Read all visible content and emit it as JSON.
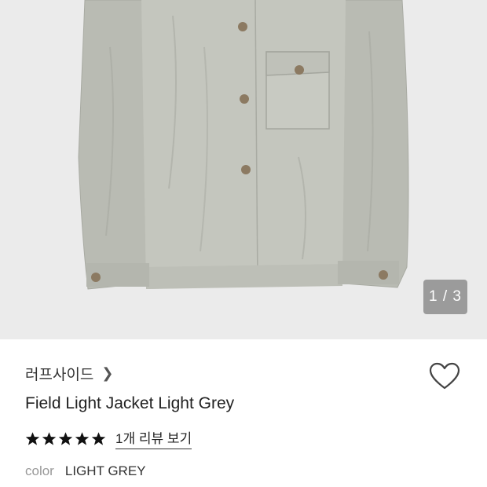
{
  "gallery": {
    "current": "1",
    "total": "3",
    "indicator": "1 / 3"
  },
  "product": {
    "brand": "러프사이드",
    "title": "Field Light Jacket Light Grey",
    "rating": 5,
    "review_link": "1개 리뷰 보기",
    "color_label": "color",
    "color_value": "LIGHT GREY"
  },
  "icons": {
    "brand_chevron": "chevron-right-icon",
    "wishlist": "heart-icon",
    "star": "star-icon"
  },
  "colors": {
    "background": "#ebebeb",
    "jacket": "#c3c5bd",
    "accent": "#222222"
  }
}
